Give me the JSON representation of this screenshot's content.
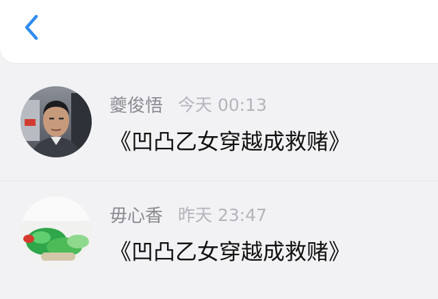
{
  "header": {
    "back_icon": "chevron-left-icon",
    "accent_color": "#2f8cf0"
  },
  "messages": [
    {
      "sender": "夔俊悟",
      "time": "今天 00:13",
      "text": "《凹凸乙女穿越成救赌》",
      "avatar": "avatar-photo-man"
    },
    {
      "sender": "毋心香",
      "time": "昨天 23:47",
      "text": "《凹凸乙女穿越成救赌》",
      "avatar": "avatar-photo-jade"
    }
  ]
}
